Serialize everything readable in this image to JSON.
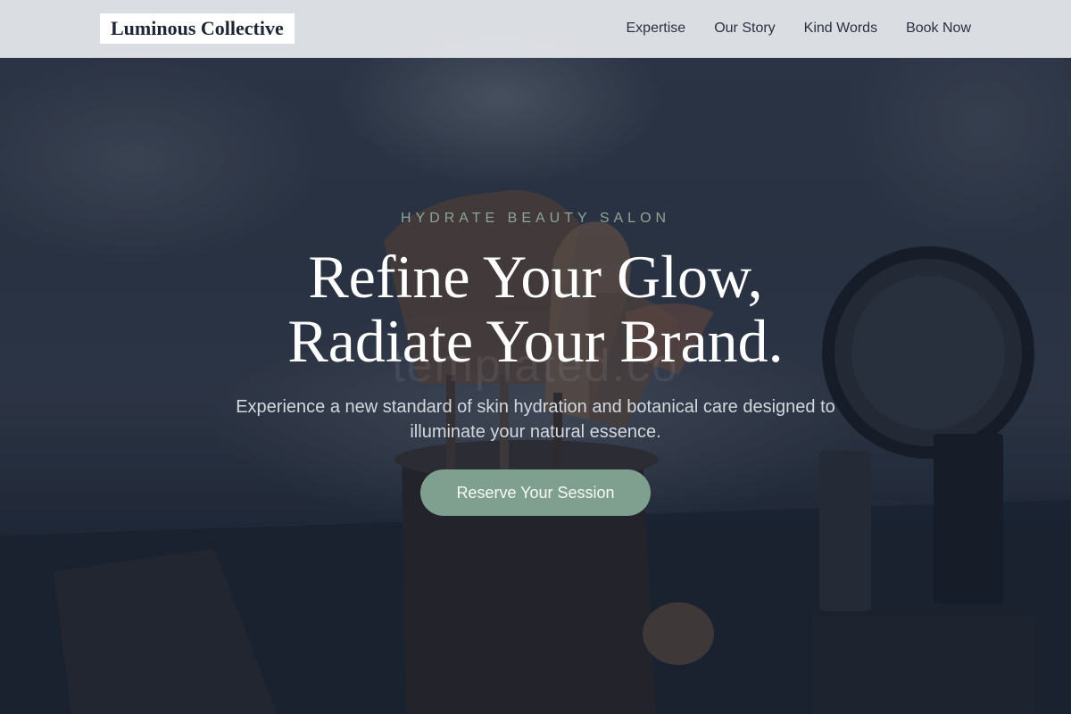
{
  "header": {
    "brand": "Luminous Collective",
    "nav": [
      {
        "label": "Expertise"
      },
      {
        "label": "Our Story"
      },
      {
        "label": "Kind Words"
      },
      {
        "label": "Book Now"
      }
    ]
  },
  "hero": {
    "eyebrow": "HYDRATE BEAUTY SALON",
    "headline_line1": "Refine Your Glow,",
    "headline_line2": "Radiate Your Brand.",
    "subcopy": "Experience a new standard of skin hydration and botanical care designed to illuminate your natural essence.",
    "cta_label": "Reserve Your Session",
    "watermark": "templated.co"
  },
  "colors": {
    "accent": "#7f9f8f",
    "eyebrow": "#8ea596",
    "overlay": "#1b2434",
    "header_bg": "#e9ecef"
  }
}
